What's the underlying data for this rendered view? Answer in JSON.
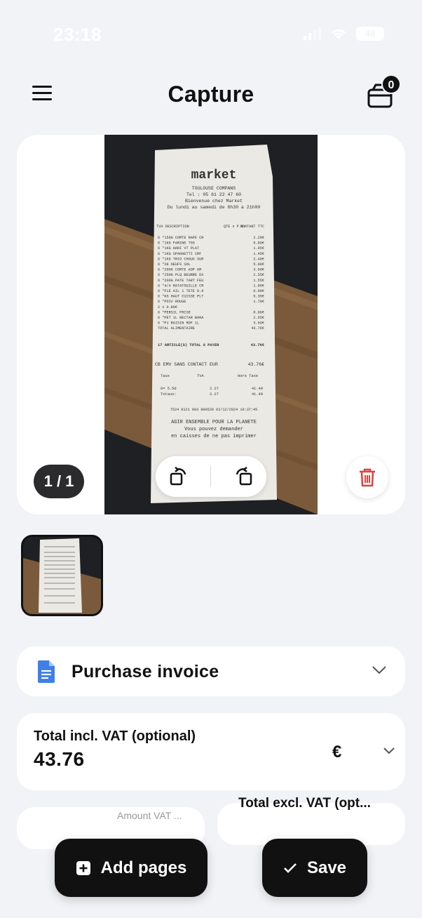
{
  "status_bar": {
    "time": "23:18",
    "battery": "48"
  },
  "header": {
    "title": "Capture",
    "cart_count": "0"
  },
  "preview": {
    "page_indicator": "1 / 1",
    "receipt": {
      "store": "market",
      "address_lines": [
        "TOULOUSE COMPANS",
        "Tel : 05 61 22 47 60",
        "Bienvenue chez Market",
        "Du lundi au samedi de 8h30 a 21h00"
      ],
      "columns": [
        "TVA",
        "DESCRIPTION",
        "QTE x P.U.",
        "MONTANT TTC"
      ],
      "items": [
        [
          "6",
          "*150G COMTE RAPE CR",
          "2.29€"
        ],
        [
          "6",
          "*1KG FARINE T55",
          "5.89€"
        ],
        [
          "6",
          "*1KG HARI VT PLAT",
          "1.95€"
        ],
        [
          "6",
          "*1KG SPAGHETTI CRF",
          "1.45€"
        ],
        [
          "6",
          "*1KG TRIO CHOUX SUR",
          "2.49€"
        ],
        [
          "6",
          "*X8 OEUFS SOL",
          "5.09€"
        ],
        [
          "6",
          "*200G COMTE AOP 6M",
          "3.50€"
        ],
        [
          "6",
          "*250G PLQ BEURRE DX",
          "2.55€"
        ],
        [
          "6",
          "*200G PATE TART FEU",
          "1.55€"
        ],
        [
          "6",
          "*4/4 RATATOUILLE CR",
          "1.95€"
        ],
        [
          "6",
          "*FLE AIL 1 TETE 0.9",
          "0.99€"
        ],
        [
          "6",
          "*KG HAUT CUISSE PLT",
          "5.35€"
        ],
        [
          "6",
          "*POIV ROUGE",
          "1.78€"
        ],
        [
          "",
          "2 x 0.89€",
          ""
        ],
        [
          "6",
          "*PERSIL FRISE",
          "0.99€"
        ],
        [
          "6",
          "*PET 1L NECTAR BANA",
          "2.55€"
        ],
        [
          "6",
          "*PJ RAISIN RDF 1L",
          "3.69€"
        ],
        [
          "",
          "TOTAL ALIMENTAIRE",
          "43.76€"
        ]
      ],
      "articles": "17 ARTICLE(S)",
      "to_pay_label": "TOTAL A PAYER",
      "to_pay": "43.76€",
      "payment": "CB EMV SANS CONTACT  EUR",
      "payment_amount": "43.76€",
      "tax_header": [
        "Taux",
        "TVA",
        "Hors Taxe"
      ],
      "tax_row": [
        "6= 5.50",
        "2.27",
        "41.49"
      ],
      "tax_total": [
        "Totaux:",
        "2.27",
        "41.49"
      ],
      "footer_line": "7524  0121  003  000528  02/12/2024  10:37:45",
      "slogan": "AGIR ENSEMBLE POUR LA PLANETE",
      "slogan_2": "Vous pouvez demander",
      "slogan_3": "en caisses de ne pas imprimer"
    }
  },
  "document_type": {
    "label": "Purchase invoice"
  },
  "total_incl_vat": {
    "label": "Total incl. VAT (optional)",
    "value": "43.76",
    "currency_symbol": "€"
  },
  "amount_vat": {
    "label": "Amount VAT ..."
  },
  "total_excl_vat": {
    "label": "Total excl. VAT (opt..."
  },
  "actions": {
    "add_pages_label": "Add pages",
    "save_label": "Save"
  },
  "icons": {
    "menu": "menu-icon",
    "cart": "cart-icon",
    "rotate_left": "rotate-left-icon",
    "rotate_right": "rotate-right-icon",
    "delete": "trash-icon",
    "document": "document-icon",
    "chevron": "chevron-down-icon",
    "add": "plus-square-icon",
    "save": "check-icon"
  },
  "colors": {
    "background": "#f1f3f7",
    "accent_blue": "#3f7fe6",
    "danger": "#e0413a",
    "button_dark": "#111111"
  }
}
